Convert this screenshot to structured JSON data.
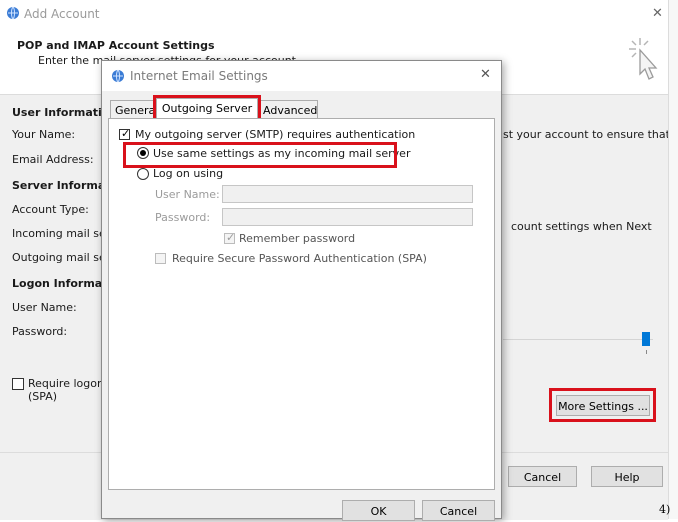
{
  "background_window": {
    "title": "Add Account",
    "close_glyph": "✕",
    "header_title": "POP and IMAP Account Settings",
    "header_subtitle": "Enter the mail server settings for your account.",
    "sections": {
      "user_information": "User Information",
      "your_name": "Your Name:",
      "email_address": "Email Address:",
      "server_information": "Server Informatio",
      "account_type": "Account Type:",
      "incoming_mail": "Incoming mail ser",
      "outgoing_mail": "Outgoing mail se",
      "logon_information": "Logon Informatio",
      "user_name": "User Name:",
      "password": "Password:",
      "require_logon": "Require logon",
      "spa": "(SPA)"
    },
    "right_text_1": "st your account to ensure that",
    "right_text_2": "count settings when Next",
    "more_settings_label": "More Settings ...",
    "cancel_label": "Cancel",
    "help_label": "Help",
    "page_marker": "4)"
  },
  "dialog": {
    "title": "Internet Email Settings",
    "close_glyph": "✕",
    "tabs": [
      "General",
      "Outgoing Server",
      "Advanced"
    ],
    "active_tab": "Outgoing Server",
    "smtp_auth_label": "My outgoing server (SMTP) requires authentication",
    "smtp_auth_checked": true,
    "use_same_settings_label": "Use same settings as my incoming mail server",
    "log_on_using_label": "Log on using",
    "user_name_label": "User Name:",
    "password_label": "Password:",
    "user_name_value": "",
    "password_value": "",
    "remember_password_label": "Remember password",
    "remember_password_checked": true,
    "spa_label": "Require Secure Password Authentication (SPA)",
    "ok_label": "OK",
    "cancel_label": "Cancel"
  },
  "colors": {
    "highlight_red": "#d9111b",
    "dialog_background": "#f0f0f0",
    "slider_blue": "#0078d7"
  }
}
